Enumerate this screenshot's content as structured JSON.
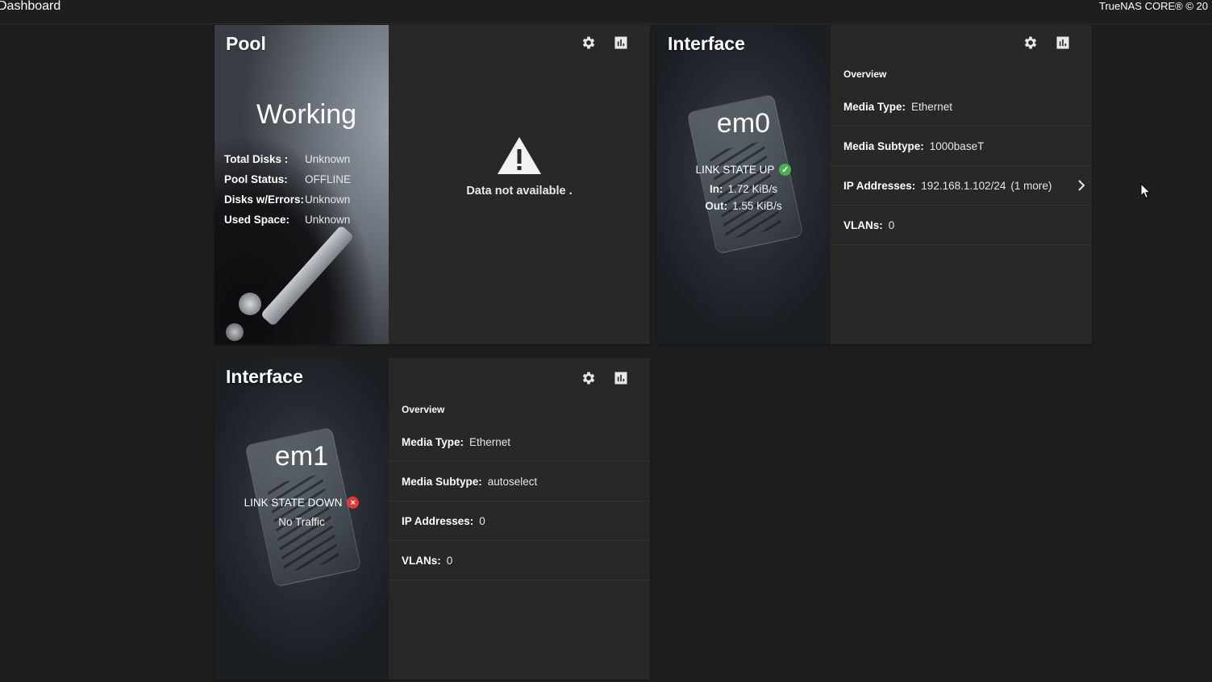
{
  "topbar": {
    "title": "Dashboard",
    "copyright": "TrueNAS CORE® © 20"
  },
  "pool_card": {
    "title": "Pool",
    "status": "Working",
    "stats": [
      {
        "label": "Total Disks :",
        "value": "Unknown"
      },
      {
        "label": "Pool Status:",
        "value": "OFFLINE"
      },
      {
        "label": "Disks w/Errors:",
        "value": "Unknown"
      },
      {
        "label": "Used Space:",
        "value": "Unknown"
      }
    ],
    "no_data_message": "Data not available ."
  },
  "interface_em0": {
    "title": "Interface",
    "name": "em0",
    "link_state": "LINK STATE UP",
    "link_status_color": "#4caf50",
    "traffic_in_label": "In:",
    "traffic_in": "1.72 KiB/s",
    "traffic_out_label": "Out:",
    "traffic_out": "1.55 KiB/s",
    "overview_title": "Overview",
    "rows": [
      {
        "label": "Media Type:",
        "value": "Ethernet"
      },
      {
        "label": "Media Subtype:",
        "value": "1000baseT"
      },
      {
        "label": "IP Addresses:",
        "value": "192.168.1.102/24",
        "more": "(1 more)"
      },
      {
        "label": "VLANs:",
        "value": "0"
      }
    ]
  },
  "interface_em1": {
    "title": "Interface",
    "name": "em1",
    "link_state": "LINK STATE DOWN",
    "link_status_color": "#e53935",
    "traffic_text": "No Traffic",
    "overview_title": "Overview",
    "rows": [
      {
        "label": "Media Type:",
        "value": "Ethernet"
      },
      {
        "label": "Media Subtype:",
        "value": "autoselect"
      },
      {
        "label": "IP Addresses:",
        "value": "0"
      },
      {
        "label": "VLANs:",
        "value": "0"
      }
    ]
  },
  "icons": {
    "settings": "gear-icon",
    "reports": "bar-chart-icon",
    "warning": "warning-icon",
    "link_up": "check-circle-icon",
    "link_down": "cancel-circle-icon",
    "expand": "chevron-right-icon"
  }
}
